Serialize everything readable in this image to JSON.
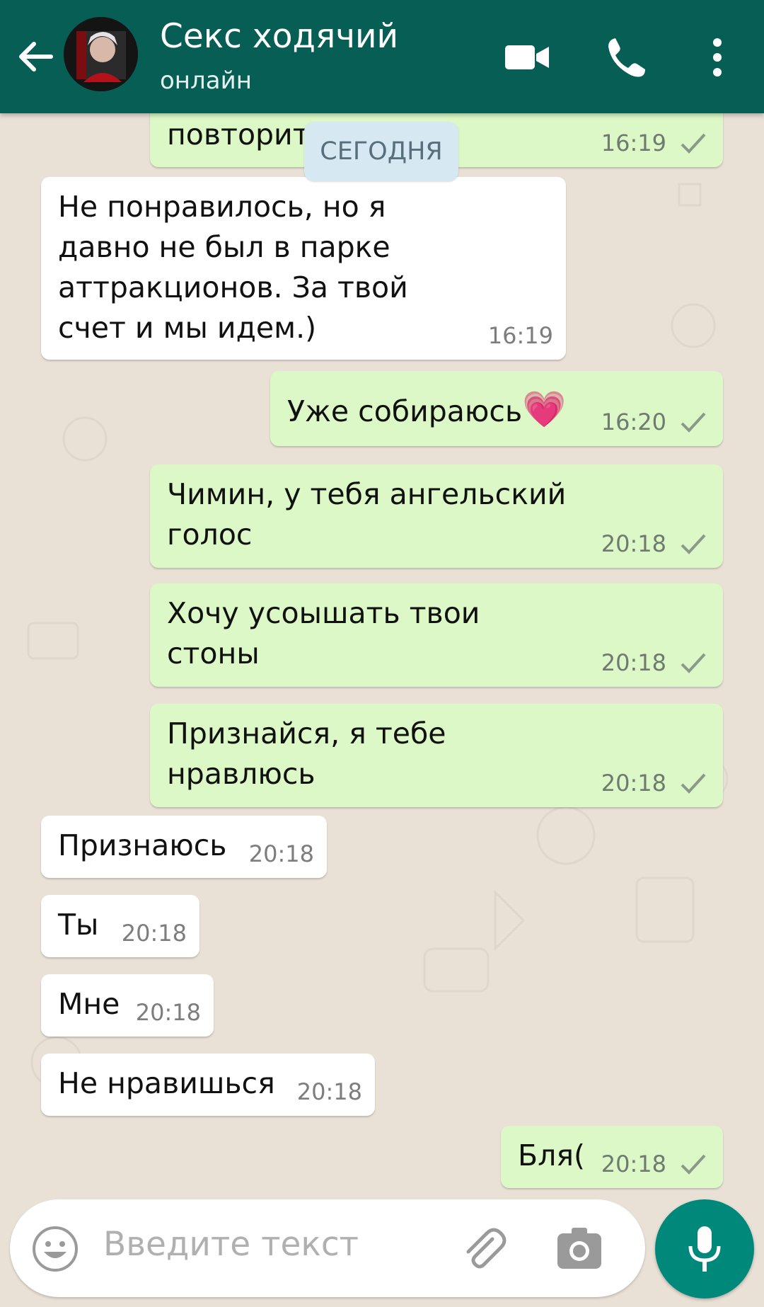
{
  "header": {
    "contact_name": "Секс ходячий",
    "status": "онлайн"
  },
  "date_divider": "СЕГОДНЯ",
  "messages": [
    {
      "direction": "out",
      "text": "повторит",
      "time": "16:19"
    },
    {
      "direction": "in",
      "text": "Не понравилось, но я\nдавно не был в парке\nаттракционов. За твой\nсчет и мы идем.)",
      "time": "16:19"
    },
    {
      "direction": "out",
      "text": "Уже собираюсь",
      "time": "16:20",
      "emoji": "💗"
    },
    {
      "direction": "out",
      "text": "Чимин, у тебя ангельский\nголос",
      "time": "20:18"
    },
    {
      "direction": "out",
      "text": "Хочу усоышать твои\nстоны",
      "time": "20:18"
    },
    {
      "direction": "out",
      "text": "Признайся, я тебе\nнравлюсь",
      "time": "20:18"
    },
    {
      "direction": "in",
      "text": "Признаюсь",
      "time": "20:18"
    },
    {
      "direction": "in",
      "text": "Ты",
      "time": "20:18"
    },
    {
      "direction": "in",
      "text": "Мне",
      "time": "20:18"
    },
    {
      "direction": "in",
      "text": "Не нравишься",
      "time": "20:18"
    },
    {
      "direction": "out",
      "text": "Бля(",
      "time": "20:18"
    }
  ],
  "composer": {
    "placeholder": "Введите текст"
  },
  "colors": {
    "header": "#075e54",
    "outgoing_bubble": "#dcf8c6",
    "incoming_bubble": "#ffffff",
    "mic_button": "#00897b",
    "date_pill": "#d6e9f3"
  },
  "icons": [
    "back-arrow-icon",
    "video-call-icon",
    "phone-icon",
    "more-vert-icon",
    "emoji-icon",
    "attach-icon",
    "camera-icon",
    "mic-icon",
    "read-check-icon"
  ]
}
